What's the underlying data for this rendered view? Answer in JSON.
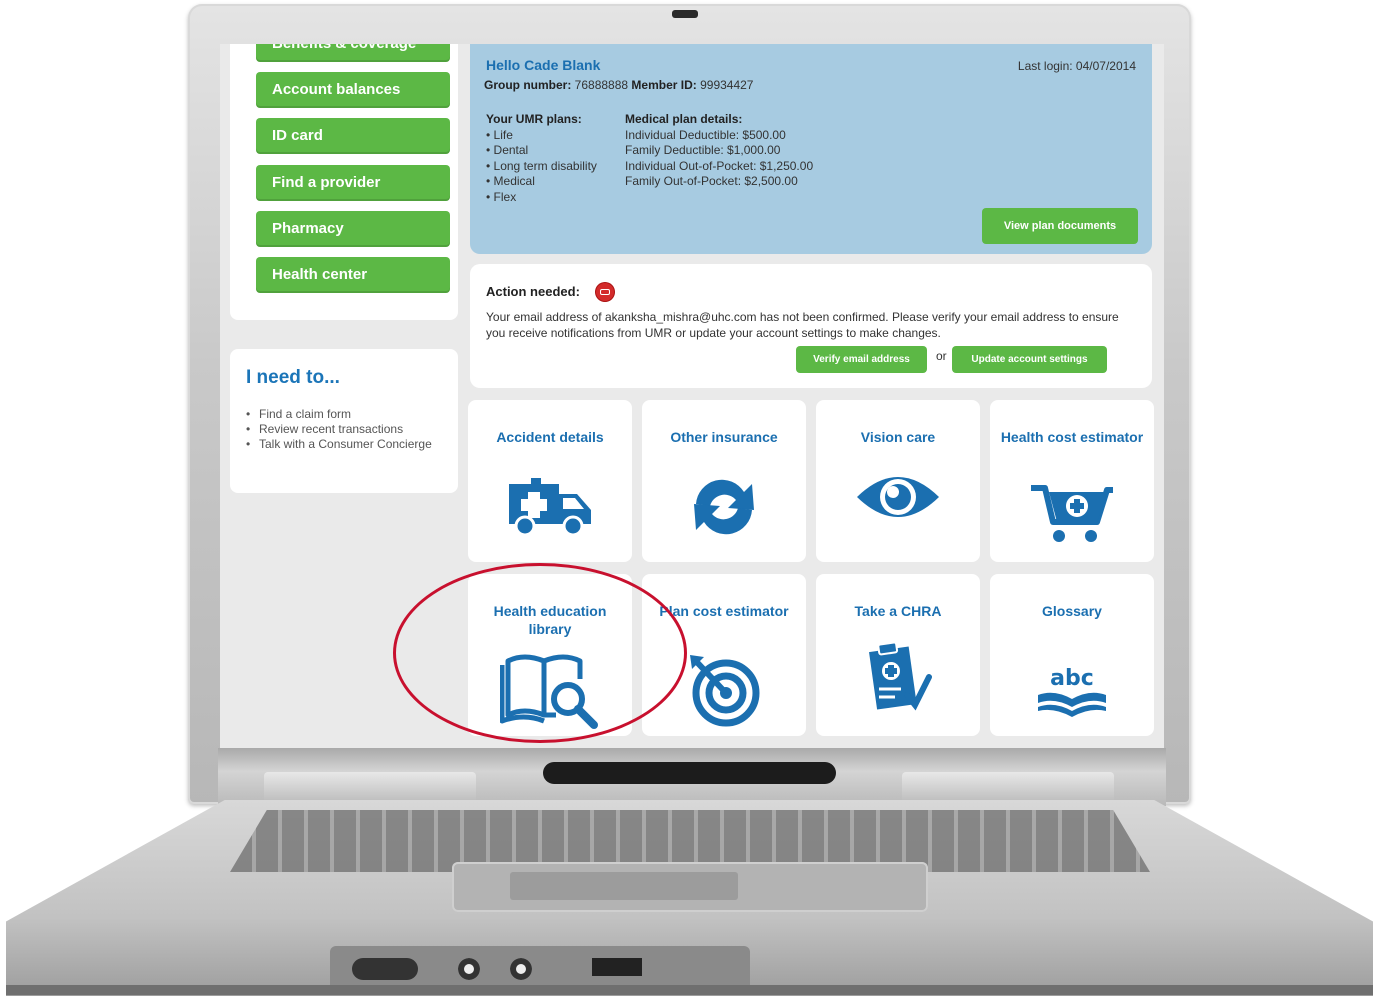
{
  "nav": {
    "items": [
      {
        "label": "Benefits & coverage"
      },
      {
        "label": "Account balances"
      },
      {
        "label": "ID card"
      },
      {
        "label": "Find a provider"
      },
      {
        "label": "Pharmacy"
      },
      {
        "label": "Health center"
      }
    ]
  },
  "need": {
    "title": "I need to...",
    "items": [
      "Find a claim form",
      "Review recent transactions",
      "Talk with a Consumer Concierge"
    ]
  },
  "account": {
    "greeting": "Hello Cade Blank",
    "last_login": "Last login: 04/07/2014",
    "group_label": "Group number:",
    "group_value": "76888888",
    "member_label": "Member ID:",
    "member_value": "99934427",
    "plans_title": "Your UMR plans:",
    "plans": [
      "• Life",
      "• Dental",
      "• Long term disability",
      "• Medical",
      "• Flex"
    ],
    "details_title": "Medical plan details:",
    "details": [
      "Individual Deductible: $500.00",
      "Family Deductible: $1,000.00",
      "Individual Out-of-Pocket: $1,250.00",
      "Family Out-of-Pocket: $2,500.00"
    ],
    "view_docs": "View plan documents"
  },
  "action": {
    "title": "Action needed:",
    "message": "Your email address of akanksha_mishra@uhc.com has not been confirmed. Please verify your email address to ensure you receive notifications from UMR or update your account settings to make changes.",
    "verify": "Verify email address",
    "or": "or",
    "update": "Update account settings"
  },
  "tiles": [
    {
      "label": "Accident details",
      "icon": "ambulance-icon"
    },
    {
      "label": "Other insurance",
      "icon": "refresh-arrows-icon"
    },
    {
      "label": "Vision care",
      "icon": "eye-icon"
    },
    {
      "label": "Health cost estimator",
      "icon": "medical-cart-icon"
    },
    {
      "label": "Health education library",
      "icon": "book-magnifier-icon"
    },
    {
      "label": "Plan cost estimator",
      "icon": "target-icon"
    },
    {
      "label": "Take a CHRA",
      "icon": "clipboard-check-icon"
    },
    {
      "label": "Glossary",
      "icon": "abc-book-icon"
    },
    {
      "glossary_icon_text": "abc"
    }
  ],
  "colors": {
    "green": "#5cb845",
    "blue": "#1b6fb0",
    "panel": "#a7cbe1",
    "highlight": "#c8102e"
  }
}
